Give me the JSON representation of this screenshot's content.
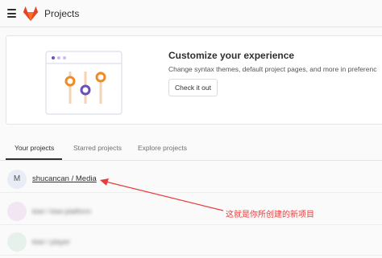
{
  "header": {
    "menu_icon": "hamburger-menu-icon",
    "logo_icon": "gitlab-fox-logo",
    "title": "Projects"
  },
  "promo": {
    "title": "Customize your experience",
    "description": "Change syntax themes, default project pages, and more in preferenc",
    "button_label": "Check it out",
    "illustration_icon": "settings-sliders-illustration"
  },
  "tabs": [
    {
      "label": "Your projects",
      "active": true
    },
    {
      "label": "Starred projects",
      "active": false
    },
    {
      "label": "Explore projects",
      "active": false
    }
  ],
  "projects": [
    {
      "avatar_letter": "M",
      "name": "shucancan / Media",
      "avatar_color": "#e8ecf7"
    },
    {
      "avatar_letter": "",
      "name": "kiwi / kiwi-platform",
      "avatar_color": "#f1e6f1"
    },
    {
      "avatar_letter": "",
      "name": "kiwi / player",
      "avatar_color": "#e6f1ec"
    }
  ],
  "annotation": {
    "text": "这就是你所创建的新项目",
    "color": "#e83c3c"
  },
  "colors": {
    "accent": "#2e2e2e",
    "annotation": "#e83c3c",
    "slider_orange": "#f08a24",
    "slider_purple": "#6b4fbb"
  }
}
